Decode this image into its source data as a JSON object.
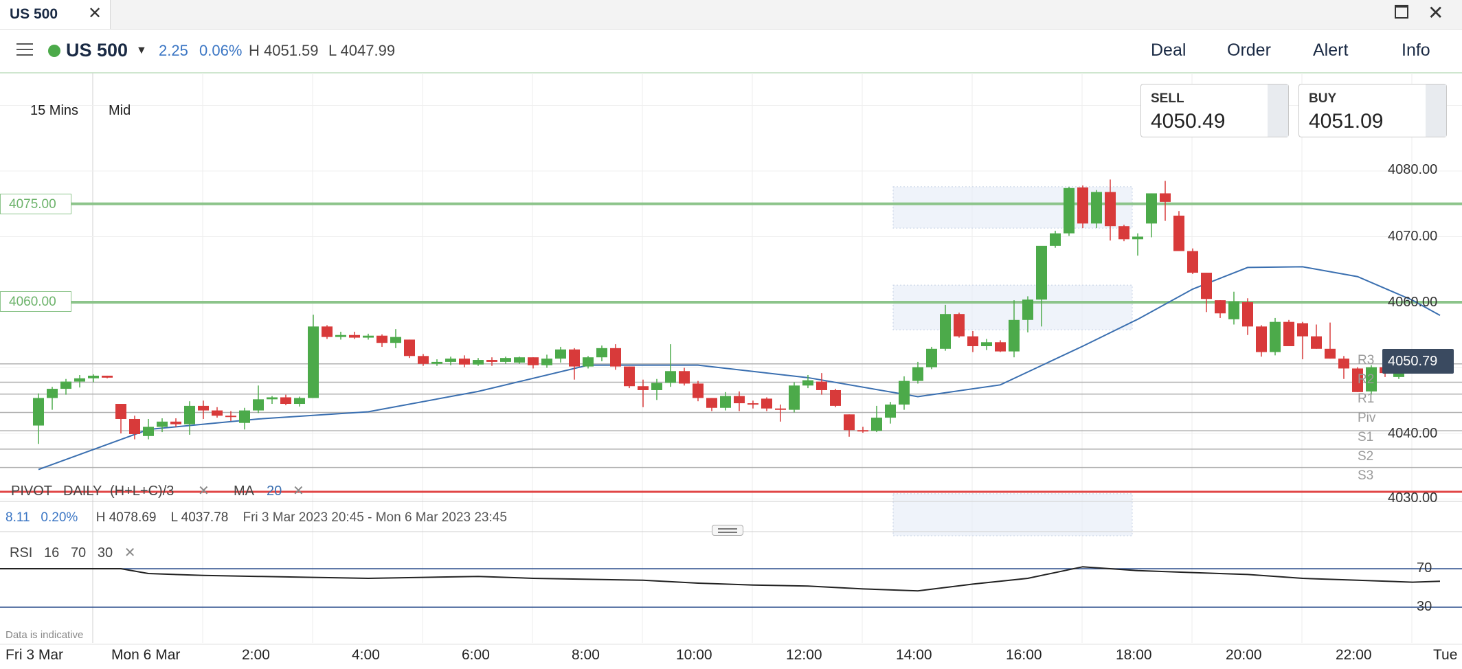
{
  "window": {
    "tab_title": "US 500",
    "close_glyph": "✕"
  },
  "header": {
    "market": "US 500",
    "change": "2.25",
    "change_pct": "0.06%",
    "high": "H 4051.59",
    "low": "L 4047.99",
    "nav": [
      "Deal",
      "Order",
      "Alert",
      "Info"
    ]
  },
  "chart_settings": {
    "timeframe": "15 Mins",
    "price_type": "Mid"
  },
  "tickets": {
    "sell_label": "SELL",
    "sell_price": "4050.49",
    "buy_label": "BUY",
    "buy_price": "4051.09"
  },
  "price_axis": {
    "labels": [
      "4080.00",
      "4070.00",
      "4060.00",
      "4050.00",
      "4040.00",
      "4030.00"
    ],
    "last_price": "4050.79"
  },
  "levels": [
    {
      "label": "4075.00",
      "value": 4075
    },
    {
      "label": "4060.00",
      "value": 4060
    }
  ],
  "pivots": [
    {
      "label": "R3",
      "value": 4050.6
    },
    {
      "label": "R2",
      "value": 4047.8
    },
    {
      "label": "R1",
      "value": 4046.0
    },
    {
      "label": "Piv",
      "value": 4043.2
    },
    {
      "label": "S1",
      "value": 4040.4
    },
    {
      "label": "S2",
      "value": 4037.6
    },
    {
      "label": "S3",
      "value": 4034.8
    }
  ],
  "indicators": {
    "pivot_name": "PIVOT",
    "pivot_period": "DAILY",
    "pivot_formula": "(H+L+C)/3",
    "ma_name": "MA",
    "ma_period": "20",
    "remove_glyph": "✕"
  },
  "stats": {
    "change": "8.11",
    "change_pct": "0.20%",
    "high": "H 4078.69",
    "low": "L 4037.78",
    "range": "Fri 3 Mar 2023 20:45 - Mon 6 Mar 2023 23:45"
  },
  "rsi": {
    "name": "RSI",
    "period": "16",
    "upper": "70",
    "lower": "30",
    "axis_labels": [
      "70",
      "30"
    ]
  },
  "disclaimer": "Data is indicative",
  "time_axis": [
    "Fri 3 Mar",
    "Mon 6 Mar",
    "2:00",
    "4:00",
    "6:00",
    "8:00",
    "10:00",
    "12:00",
    "14:00",
    "16:00",
    "18:00",
    "20:00",
    "22:00",
    "Tue"
  ],
  "colors": {
    "up": "#4caa4a",
    "down": "#d83a3a",
    "ma": "#3a6fb0",
    "level": "#8cc48a",
    "pivot": "#b0b0b0",
    "rsi": "#222222",
    "rsi_band": "#2a4d8c"
  },
  "chart_data": {
    "type": "candlestick",
    "y_range": [
      4027,
      4095
    ],
    "bars_per_2h": 8,
    "first_bar_time": "Fri 3 Mar 20:45",
    "candles": [
      [
        4041.2,
        4046.1,
        4038.4,
        4045.4
      ],
      [
        4045.4,
        4047.1,
        4043.6,
        4046.8
      ],
      [
        4046.8,
        4048.3,
        4045.9,
        4047.9
      ],
      [
        4047.9,
        4048.9,
        4047.0,
        4048.4
      ],
      [
        4048.4,
        4049.0,
        4047.8,
        4048.8
      ],
      [
        4048.8,
        4048.8,
        4048.4,
        4048.5
      ],
      [
        4044.5,
        4044.5,
        4040.0,
        4042.2
      ],
      [
        4042.2,
        4042.7,
        4039.1,
        4039.9
      ],
      [
        4039.6,
        4042.2,
        4039.1,
        4041.0
      ],
      [
        4041.0,
        4042.3,
        4040.2,
        4041.8
      ],
      [
        4041.8,
        4042.3,
        4041.0,
        4041.4
      ],
      [
        4041.4,
        4044.9,
        4039.8,
        4044.2
      ],
      [
        4044.2,
        4045.0,
        4042.2,
        4043.5
      ],
      [
        4043.5,
        4044.0,
        4042.4,
        4042.7
      ],
      [
        4042.7,
        4043.4,
        4041.9,
        4042.5
      ],
      [
        4041.6,
        4043.9,
        4040.6,
        4043.5
      ],
      [
        4043.5,
        4047.3,
        4043.1,
        4045.2
      ],
      [
        4045.2,
        4045.7,
        4044.5,
        4045.5
      ],
      [
        4045.5,
        4045.9,
        4044.3,
        4044.5
      ],
      [
        4044.5,
        4045.6,
        4044.1,
        4045.4
      ],
      [
        4045.4,
        4058.1,
        4045.4,
        4056.3
      ],
      [
        4056.3,
        4056.5,
        4054.4,
        4054.7
      ],
      [
        4054.7,
        4055.5,
        4054.3,
        4055.0
      ],
      [
        4055.0,
        4055.5,
        4054.4,
        4054.6
      ],
      [
        4054.6,
        4055.2,
        4054.3,
        4054.9
      ],
      [
        4054.9,
        4055.1,
        4053.2,
        4053.8
      ],
      [
        4053.8,
        4055.9,
        4053.0,
        4054.7
      ],
      [
        4054.3,
        4054.3,
        4051.5,
        4051.8
      ],
      [
        4051.8,
        4052.1,
        4050.3,
        4050.6
      ],
      [
        4050.6,
        4051.3,
        4050.3,
        4050.9
      ],
      [
        4050.9,
        4051.7,
        4050.4,
        4051.4
      ],
      [
        4051.4,
        4051.9,
        4050.1,
        4050.5
      ],
      [
        4050.5,
        4051.5,
        4050.3,
        4051.2
      ],
      [
        4051.2,
        4051.6,
        4050.3,
        4050.9
      ],
      [
        4050.9,
        4051.7,
        4050.6,
        4051.5
      ],
      [
        4050.8,
        4051.7,
        4050.6,
        4051.6
      ],
      [
        4051.6,
        4051.6,
        4049.9,
        4050.4
      ],
      [
        4050.4,
        4052.0,
        4050.0,
        4051.4
      ],
      [
        4051.4,
        4053.2,
        4050.8,
        4052.8
      ],
      [
        4052.8,
        4053.0,
        4048.2,
        4050.2
      ],
      [
        4050.2,
        4051.8,
        4049.9,
        4051.6
      ],
      [
        4051.6,
        4053.4,
        4051.0,
        4053.0
      ],
      [
        4053.0,
        4053.6,
        4049.7,
        4050.2
      ],
      [
        4050.2,
        4050.2,
        4046.9,
        4047.2
      ],
      [
        4047.2,
        4048.2,
        4044.0,
        4046.6
      ],
      [
        4046.6,
        4048.3,
        4045.1,
        4047.7
      ],
      [
        4047.7,
        4053.6,
        4047.1,
        4049.5
      ],
      [
        4049.5,
        4050.0,
        4047.3,
        4047.6
      ],
      [
        4047.6,
        4048.0,
        4044.9,
        4045.4
      ],
      [
        4045.4,
        4045.4,
        4043.4,
        4043.9
      ],
      [
        4043.9,
        4046.3,
        4043.5,
        4045.7
      ],
      [
        4045.7,
        4046.4,
        4043.4,
        4044.6
      ],
      [
        4044.6,
        4045.0,
        4043.8,
        4044.4
      ],
      [
        4045.3,
        4045.5,
        4043.4,
        4043.8
      ],
      [
        4043.8,
        4044.4,
        4041.8,
        4043.6
      ],
      [
        4043.6,
        4047.8,
        4043.2,
        4047.3
      ],
      [
        4047.3,
        4048.9,
        4046.9,
        4048.1
      ],
      [
        4047.9,
        4049.2,
        4045.9,
        4046.6
      ],
      [
        4046.6,
        4046.8,
        4044.0,
        4044.2
      ],
      [
        4042.9,
        4042.9,
        4039.5,
        4040.5
      ],
      [
        4040.5,
        4041.0,
        4040.1,
        4040.4
      ],
      [
        4040.4,
        4044.2,
        4040.2,
        4042.4
      ],
      [
        4042.4,
        4044.8,
        4041.5,
        4044.4
      ],
      [
        4044.4,
        4048.7,
        4043.6,
        4048.0
      ],
      [
        4048.0,
        4050.9,
        4047.6,
        4050.1
      ],
      [
        4050.1,
        4053.2,
        4049.8,
        4052.9
      ],
      [
        4052.9,
        4059.6,
        4052.6,
        4058.2
      ],
      [
        4058.2,
        4058.4,
        4054.6,
        4054.8
      ],
      [
        4054.8,
        4055.6,
        4052.4,
        4053.3
      ],
      [
        4053.3,
        4054.4,
        4052.7,
        4053.9
      ],
      [
        4053.9,
        4054.2,
        4052.4,
        4052.5
      ],
      [
        4052.5,
        4060.3,
        4051.6,
        4057.3
      ],
      [
        4057.3,
        4060.9,
        4055.4,
        4060.4
      ],
      [
        4060.4,
        4066.6,
        4056.3,
        4068.6
      ],
      [
        4068.6,
        4070.9,
        4068.3,
        4070.5
      ],
      [
        4070.5,
        4077.6,
        4070.1,
        4077.4
      ],
      [
        4077.5,
        4077.8,
        4071.3,
        4072.0
      ],
      [
        4072.0,
        4077.1,
        4071.3,
        4076.8
      ],
      [
        4076.8,
        4078.7,
        4069.4,
        4071.6
      ],
      [
        4071.6,
        4071.8,
        4069.3,
        4069.6
      ],
      [
        4069.6,
        4070.5,
        4067.1,
        4070.0
      ],
      [
        4072.0,
        4076.6,
        4069.9,
        4076.6
      ],
      [
        4076.6,
        4078.5,
        4072.4,
        4075.3
      ],
      [
        4073.2,
        4073.9,
        4069.4,
        4067.8
      ],
      [
        4067.8,
        4068.2,
        4064.3,
        4064.5
      ],
      [
        4064.5,
        4064.5,
        4058.5,
        4060.5
      ],
      [
        4060.3,
        4060.3,
        4057.6,
        4058.3
      ],
      [
        4057.4,
        4061.6,
        4056.6,
        4060.1
      ],
      [
        4060.0,
        4060.6,
        4055.0,
        4056.3
      ],
      [
        4056.3,
        4056.5,
        4051.7,
        4052.4
      ],
      [
        4052.4,
        4057.6,
        4051.9,
        4057.0
      ],
      [
        4057.0,
        4057.3,
        4053.3,
        4053.3
      ],
      [
        4056.8,
        4057.0,
        4051.3,
        4054.8
      ],
      [
        4054.8,
        4056.6,
        4052.9,
        4052.9
      ],
      [
        4052.9,
        4056.9,
        4051.4,
        4051.4
      ],
      [
        4051.4,
        4051.8,
        4048.3,
        4049.9
      ],
      [
        4049.9,
        4050.1,
        4046.3,
        4046.3
      ],
      [
        4046.4,
        4050.4,
        4045.9,
        4050.1
      ],
      [
        4050.1,
        4051.9,
        4048.6,
        4049.2
      ],
      [
        4048.6,
        4050.0,
        4048.3,
        4049.7
      ],
      [
        4049.7,
        4051.1,
        4049.6,
        4050.8
      ],
      [
        4050.9,
        4051.2,
        4050.6,
        4050.8
      ]
    ],
    "ma20": [
      [
        0,
        4034.5
      ],
      [
        8,
        4040.6
      ],
      [
        16,
        4042.2
      ],
      [
        24,
        4043.3
      ],
      [
        32,
        4046.4
      ],
      [
        40,
        4050.4
      ],
      [
        48,
        4050.4
      ],
      [
        56,
        4048.5
      ],
      [
        64,
        4045.6
      ],
      [
        70,
        4047.4
      ],
      [
        76,
        4053.3
      ],
      [
        80,
        4057.4
      ],
      [
        84,
        4062.0
      ],
      [
        88,
        4065.3
      ],
      [
        92,
        4065.4
      ],
      [
        96,
        4063.9
      ],
      [
        100,
        4060.3
      ],
      [
        102,
        4058.0
      ]
    ],
    "ma_window": 20,
    "rsi_values": [
      [
        -10,
        70
      ],
      [
        6,
        70
      ],
      [
        8,
        65
      ],
      [
        12,
        63
      ],
      [
        16,
        62
      ],
      [
        20,
        61
      ],
      [
        24,
        60
      ],
      [
        28,
        61
      ],
      [
        32,
        62
      ],
      [
        36,
        60
      ],
      [
        40,
        59
      ],
      [
        44,
        58
      ],
      [
        48,
        55
      ],
      [
        52,
        53
      ],
      [
        56,
        52
      ],
      [
        60,
        49
      ],
      [
        64,
        47
      ],
      [
        68,
        54
      ],
      [
        72,
        60
      ],
      [
        76,
        72
      ],
      [
        80,
        68
      ],
      [
        84,
        66
      ],
      [
        88,
        64
      ],
      [
        92,
        60
      ],
      [
        96,
        58
      ],
      [
        100,
        56
      ],
      [
        102,
        57
      ]
    ],
    "zones": [
      {
        "start": 63,
        "end": 79,
        "from": 4071.3,
        "to": 4077.6
      },
      {
        "start": 63,
        "end": 79,
        "from": 4055.8,
        "to": 4062.6
      },
      {
        "start": 63,
        "end": 79,
        "from": 4024.4,
        "to": 4030.8
      }
    ]
  }
}
